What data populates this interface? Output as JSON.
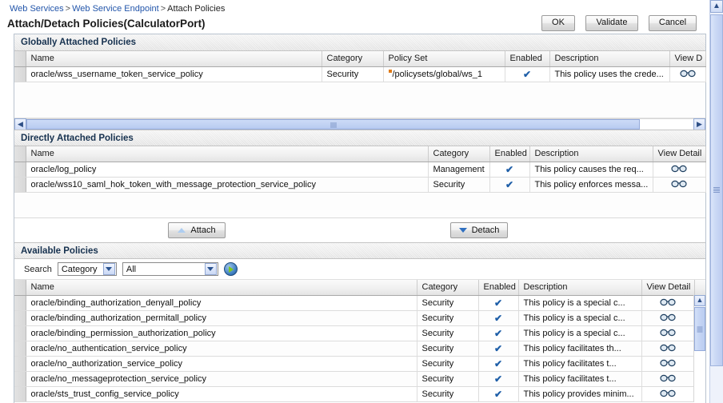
{
  "breadcrumb": {
    "item1": "Web Services",
    "sep1": ">",
    "item2": "Web Service Endpoint",
    "sep2": ">",
    "item3": "Attach Policies"
  },
  "page_title": "Attach/Detach Policies(CalculatorPort)",
  "top_buttons": {
    "ok": "OK",
    "validate": "Validate",
    "cancel": "Cancel"
  },
  "colors": {
    "link": "#2255aa",
    "section_title": "#16314f",
    "checkmark": "#1f5fa8",
    "policyset_marker": "#e07b18",
    "go_arrow": "#7ec820",
    "scrollbar": "#c3d4f4"
  },
  "globally_attached": {
    "title": "Globally Attached Policies",
    "columns": [
      "Name",
      "Category",
      "Policy Set",
      "Enabled",
      "Description",
      "View D"
    ],
    "rows": [
      {
        "name": "oracle/wss_username_token_service_policy",
        "category": "Security",
        "policy_set": "/policysets/global/ws_1",
        "enabled": "✔",
        "description": "This policy uses the crede...",
        "view_detail": "view-detail-icon"
      }
    ],
    "hscroll": {
      "left_arrow": "◀",
      "right_arrow": "▶"
    }
  },
  "directly_attached": {
    "title": "Directly Attached Policies",
    "columns": [
      "Name",
      "Category",
      "Enabled",
      "Description",
      "View Detail"
    ],
    "rows": [
      {
        "name": "oracle/log_policy",
        "category": "Management",
        "enabled": "✔",
        "description": "This policy causes the req...",
        "view_detail": "view-detail-icon"
      },
      {
        "name": "oracle/wss10_saml_hok_token_with_message_protection_service_policy",
        "category": "Security",
        "enabled": "✔",
        "description": "This policy enforces messa...",
        "view_detail": "view-detail-icon"
      }
    ]
  },
  "actions": {
    "attach": "Attach",
    "detach": "Detach"
  },
  "available": {
    "title": "Available Policies",
    "search": {
      "label": "Search",
      "field_value": "Category",
      "value_value": "All",
      "go_label": "Go"
    },
    "columns": [
      "Name",
      "Category",
      "Enabled",
      "Description",
      "View Detail"
    ],
    "rows": [
      {
        "name": "oracle/binding_authorization_denyall_policy",
        "category": "Security",
        "enabled": "✔",
        "description": "This policy is a special c...",
        "view_detail": "view-detail-icon"
      },
      {
        "name": "oracle/binding_authorization_permitall_policy",
        "category": "Security",
        "enabled": "✔",
        "description": "This policy is a special c...",
        "view_detail": "view-detail-icon"
      },
      {
        "name": "oracle/binding_permission_authorization_policy",
        "category": "Security",
        "enabled": "✔",
        "description": "This policy is a special c...",
        "view_detail": "view-detail-icon"
      },
      {
        "name": "oracle/no_authentication_service_policy",
        "category": "Security",
        "enabled": "✔",
        "description": "This policy facilitates th...",
        "view_detail": "view-detail-icon"
      },
      {
        "name": "oracle/no_authorization_service_policy",
        "category": "Security",
        "enabled": "✔",
        "description": "This policy facilitates t...",
        "view_detail": "view-detail-icon"
      },
      {
        "name": "oracle/no_messageprotection_service_policy",
        "category": "Security",
        "enabled": "✔",
        "description": "This policy facilitates t...",
        "view_detail": "view-detail-icon"
      },
      {
        "name": "oracle/sts_trust_config_service_policy",
        "category": "Security",
        "enabled": "✔",
        "description": "This policy provides minim...",
        "view_detail": "view-detail-icon"
      }
    ]
  }
}
